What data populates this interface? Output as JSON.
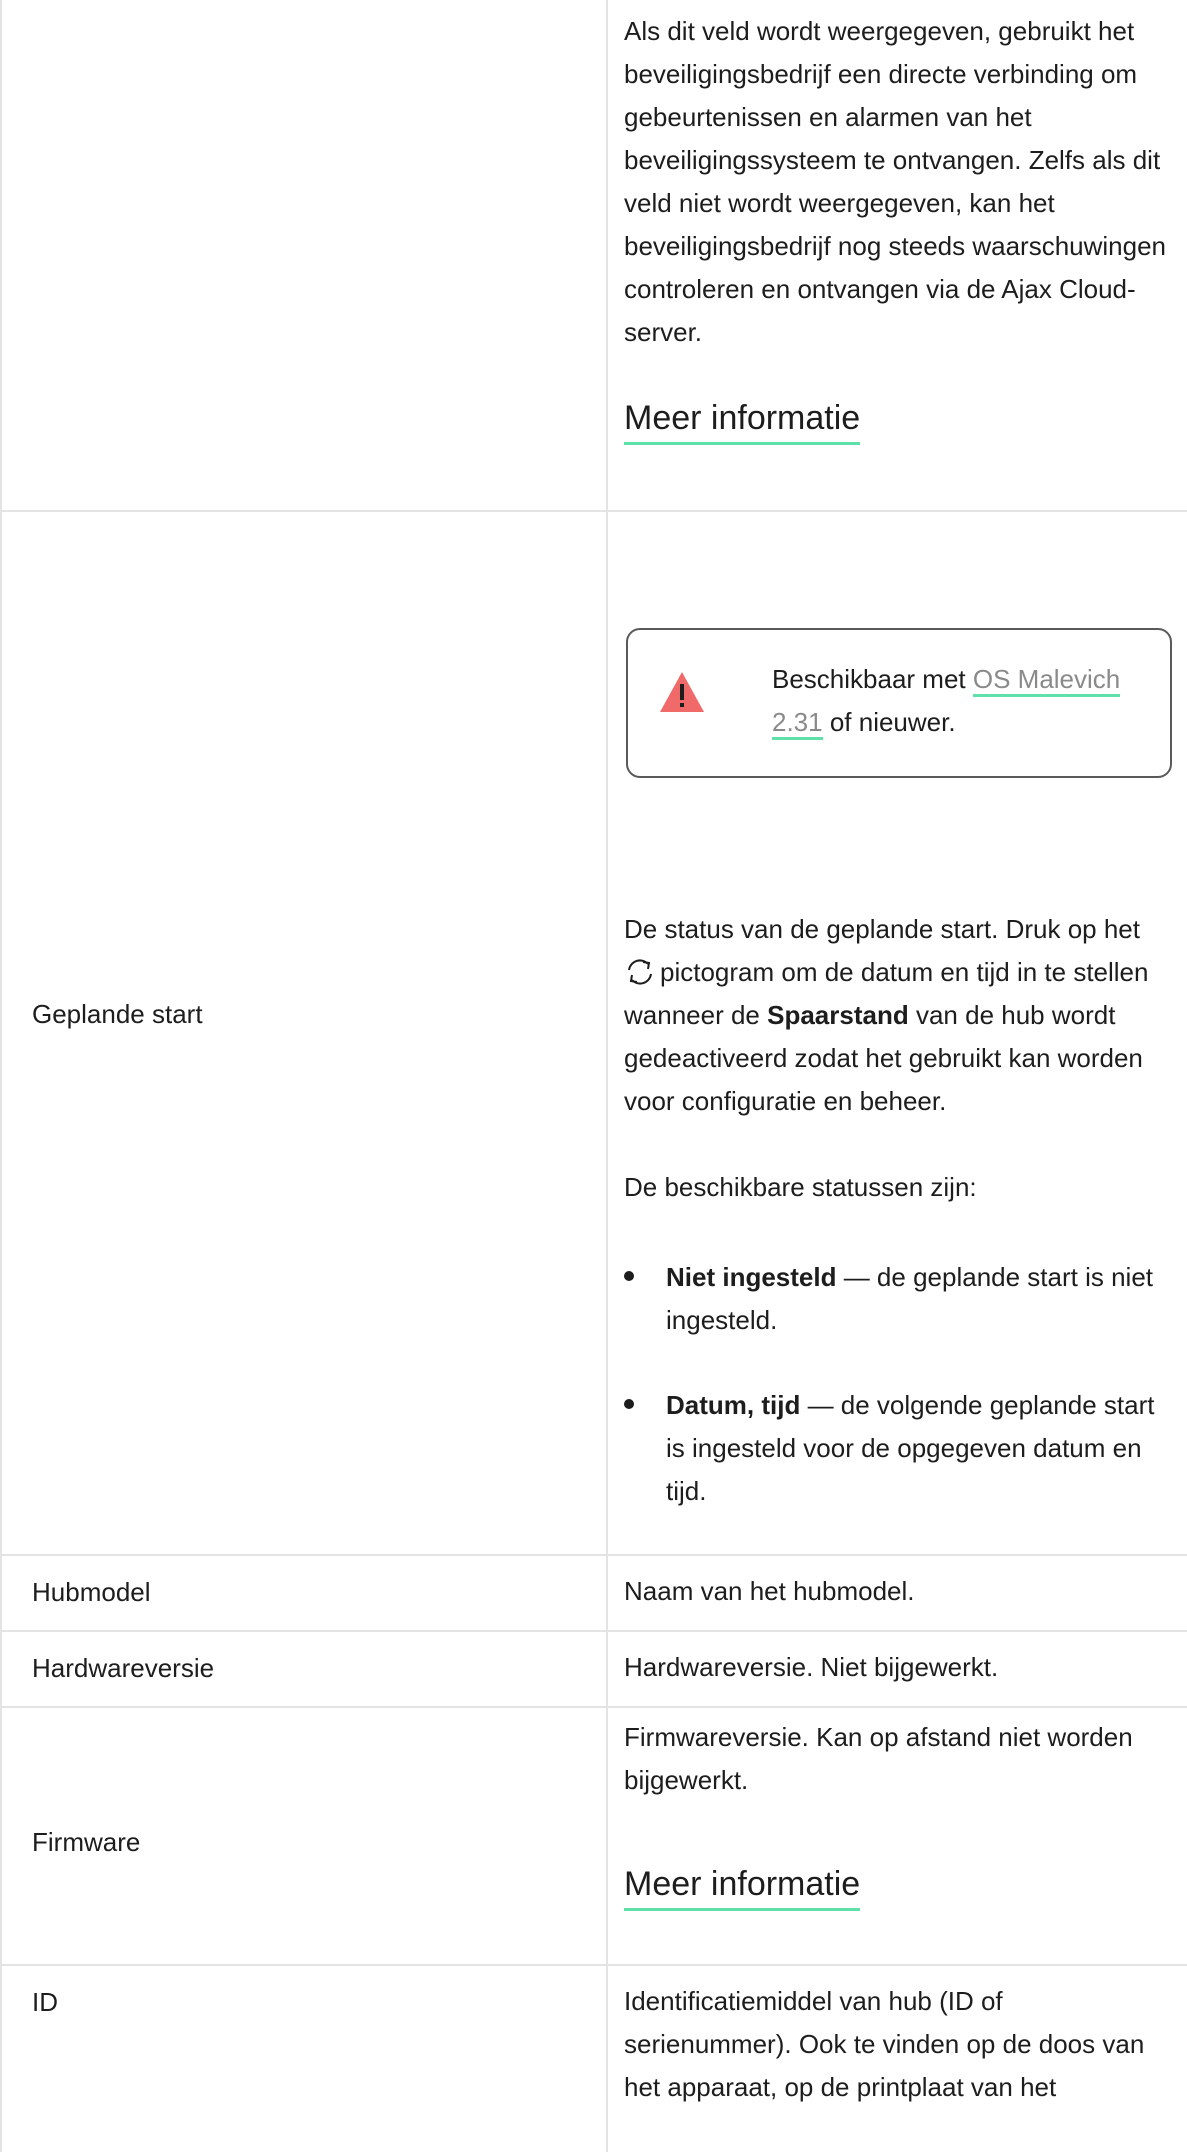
{
  "rows": {
    "monitoring": {
      "text": "Als dit veld wordt weergegeven, gebruikt het beveiligingsbedrijf een directe verbinding om gebeurtenissen en alarmen van het beveiligingssysteem te ontvangen. Zelfs als dit veld niet wordt weergegeven, kan het beveiligingsbedrijf nog steeds waarschuwingen controleren en ontvangen via de Ajax Cloud-server.",
      "link": "Meer informatie"
    },
    "scheduled_start": {
      "label": "Geplande start",
      "note_prefix": "Beschikbaar met ",
      "note_link": "OS Malevich 2.31",
      "note_suffix": " of nieuwer.",
      "desc_1": "De status van de geplande start. Druk op het",
      "desc_2": "pictogram om de datum en tijd in te stellen wanneer de",
      "desc_bold": "Spaarstand",
      "desc_3": "van de hub wordt gedeactiveerd zodat het gebruikt kan worden voor configuratie en beheer.",
      "statuses_intro": "De beschikbare statussen zijn:",
      "bullets": [
        {
          "bold": "Niet ingesteld",
          "text": " — de geplande start is niet ingesteld."
        },
        {
          "bold": "Datum, tijd",
          "text": " — de volgende geplande start is ingesteld voor de opgegeven datum en tijd."
        }
      ]
    },
    "hub_model": {
      "label": "Hubmodel",
      "text": "Naam van het hubmodel."
    },
    "hardware": {
      "label": "Hardwareversie",
      "text": "Hardwareversie. Niet bijgewerkt."
    },
    "firmware": {
      "label": "Firmware",
      "text": "Firmwareversie. Kan op afstand niet worden bijgewerkt.",
      "link": "Meer informatie"
    },
    "id": {
      "label": "ID",
      "text": "Identificatiemiddel van hub (ID of serienummer). Ook te vinden op de doos van het apparaat, op de printplaat van het"
    }
  },
  "colors": {
    "accent_underline": "#5ee0a8",
    "warning": "#f06a6a",
    "border": "#e3e3e3"
  },
  "icons": {
    "warning": "warning-triangle-icon",
    "refresh": "refresh-icon"
  }
}
